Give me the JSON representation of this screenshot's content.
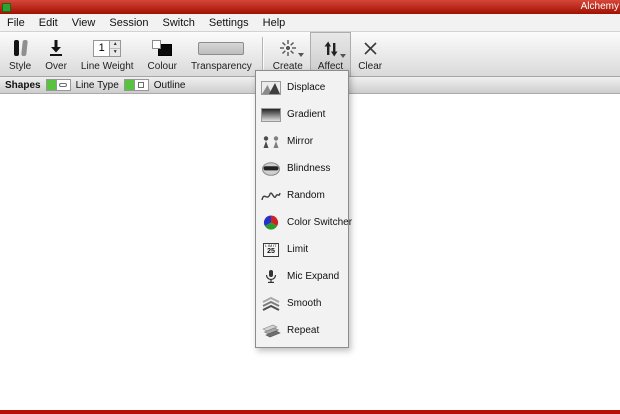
{
  "window": {
    "title": "Alchemy"
  },
  "menubar": {
    "items": [
      "File",
      "Edit",
      "View",
      "Session",
      "Switch",
      "Settings",
      "Help"
    ]
  },
  "toolbar": {
    "style_label": "Style",
    "over_label": "Over",
    "line_weight_label": "Line Weight",
    "line_weight_value": "1",
    "colour_label": "Colour",
    "transparency_label": "Transparency",
    "create_label": "Create",
    "affect_label": "Affect",
    "clear_label": "Clear"
  },
  "subtoolbar": {
    "shapes_label": "Shapes",
    "line_type_label": "Line Type",
    "outline_label": "Outline"
  },
  "affect_menu": {
    "items": [
      {
        "label": "Displace",
        "icon": "displace-icon"
      },
      {
        "label": "Gradient",
        "icon": "gradient-icon"
      },
      {
        "label": "Mirror",
        "icon": "mirror-icon"
      },
      {
        "label": "Blindness",
        "icon": "blindness-icon"
      },
      {
        "label": "Random",
        "icon": "random-icon"
      },
      {
        "label": "Color Switcher",
        "icon": "color-switcher-icon"
      },
      {
        "label": "Limit",
        "icon": "limit-icon"
      },
      {
        "label": "Mic Expand",
        "icon": "mic-expand-icon"
      },
      {
        "label": "Smooth",
        "icon": "smooth-icon"
      },
      {
        "label": "Repeat",
        "icon": "repeat-icon"
      }
    ]
  },
  "limit_icon": {
    "top_text": "LIMIT",
    "number": "25"
  },
  "colors": {
    "titlebar_red": "#b51205",
    "toggle_green": "#58c33e",
    "menu_bg": "#f2f2f2"
  }
}
